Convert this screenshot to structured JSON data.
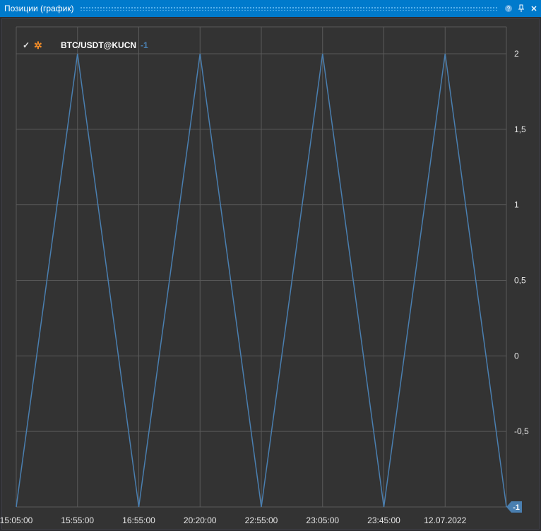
{
  "window": {
    "title": "Позиции (график)",
    "help_icon": "help-icon",
    "pin_icon": "pin-icon",
    "close_icon": "close-icon"
  },
  "legend": {
    "check_icon": "check-icon",
    "settings_icon": "gear-icon",
    "symbol": "BTC/USDT@KUCN",
    "value": "-1",
    "color": "#4a7fb0"
  },
  "chart_data": {
    "type": "line",
    "x_tick_labels": [
      "15:05:00",
      "15:55:00",
      "16:55:00",
      "20:20:00",
      "22:55:00",
      "23:05:00",
      "23:45:00",
      "12.07.2022"
    ],
    "y_tick_labels": [
      "2",
      "1,5",
      "1",
      "0,5",
      "0",
      "-0,5"
    ],
    "y_ticks": [
      2,
      1.5,
      1,
      0.5,
      0,
      -0.5
    ],
    "ylim": [
      -1,
      2
    ],
    "series": [
      {
        "color": "#4a7fb0",
        "x": [
          0,
          1,
          2,
          3,
          4,
          5,
          6,
          7,
          8
        ],
        "y": [
          -1,
          2,
          -1,
          2,
          -1,
          2,
          -1,
          2,
          -1
        ]
      }
    ],
    "last_value_label": "-1",
    "grid": true,
    "y_axis_position": "right"
  }
}
